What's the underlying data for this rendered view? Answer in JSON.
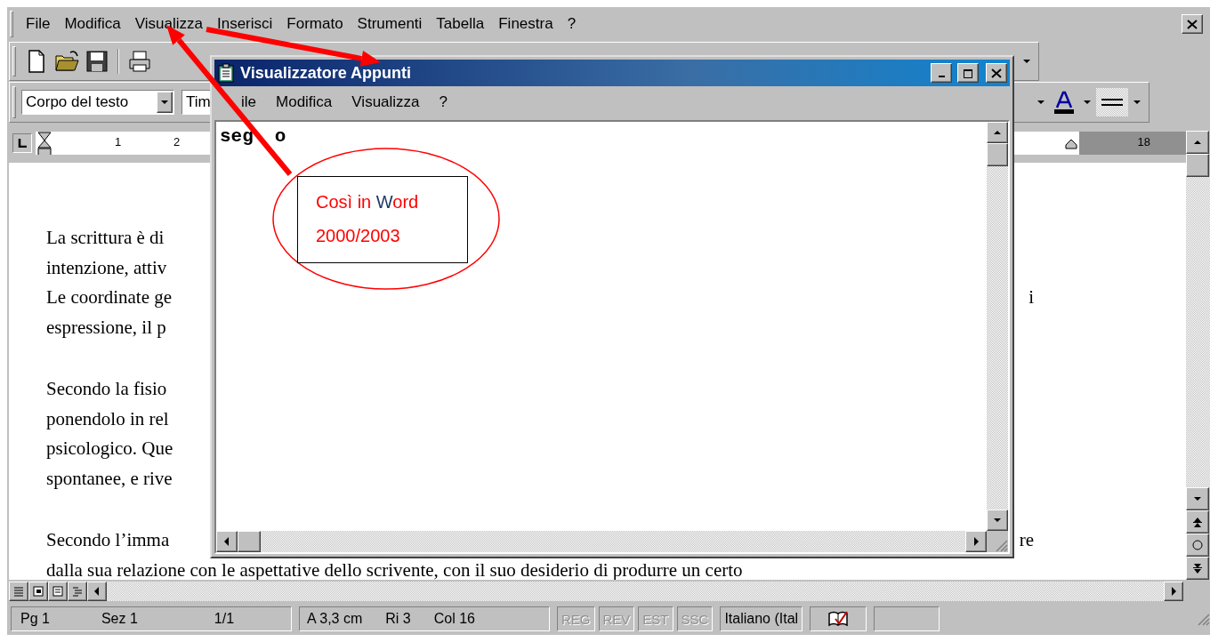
{
  "menu_bar": {
    "items": [
      "File",
      "Modifica",
      "Visualizza",
      "Inserisci",
      "Formato",
      "Strumenti",
      "Tabella",
      "Finestra",
      "?"
    ]
  },
  "formatting_toolbar": {
    "style": "Corpo del testo",
    "font": "Tim"
  },
  "ruler": {
    "left_marks": [
      "1",
      "2"
    ],
    "right_marks": [
      "18"
    ]
  },
  "document": {
    "paragraphs": [
      {
        "lines": [
          {
            "text": "La scrittura è di"
          },
          {
            "text": "intenzione, attiv"
          },
          {
            "text": "Le coordinate ge",
            "right": "i"
          },
          {
            "text": "espressione, il p"
          }
        ]
      },
      {
        "lines": [
          {
            "text": "Secondo la fisio"
          },
          {
            "text": "ponendolo in rel"
          },
          {
            "text": "psicologico. Que"
          },
          {
            "text": "spontanee, e rive"
          }
        ]
      },
      {
        "lines": [
          {
            "text": "Secondo l’imma",
            "right": "re"
          },
          {
            "text": "dalla sua relazione con le aspettative dello scrivente, con il suo desiderio di produrre un certo"
          }
        ]
      }
    ]
  },
  "status_bar": {
    "position": [
      "Pg 1",
      "Sez 1",
      "1/1"
    ],
    "cursor": [
      "A 3,3 cm",
      "Ri 3",
      "Col 16"
    ],
    "modes": [
      {
        "label": "REG",
        "disabled": true
      },
      {
        "label": "REV",
        "disabled": true
      },
      {
        "label": "EST",
        "disabled": true
      },
      {
        "label": "SSC",
        "disabled": true
      }
    ],
    "language": "Italiano (Ital"
  },
  "clipboard_window": {
    "title": "Visualizzatore Appunti",
    "menu": [
      "ile",
      "Modifica",
      "Visualizza",
      "?"
    ],
    "content": [
      "seg",
      "o"
    ]
  },
  "callout": {
    "parts": [
      {
        "text": "Così in ",
        "color": "#ff0000"
      },
      {
        "text": "W",
        "color": "#1f3864"
      },
      {
        "text": "ord 2000/2003",
        "color": "#ff0000"
      }
    ]
  }
}
